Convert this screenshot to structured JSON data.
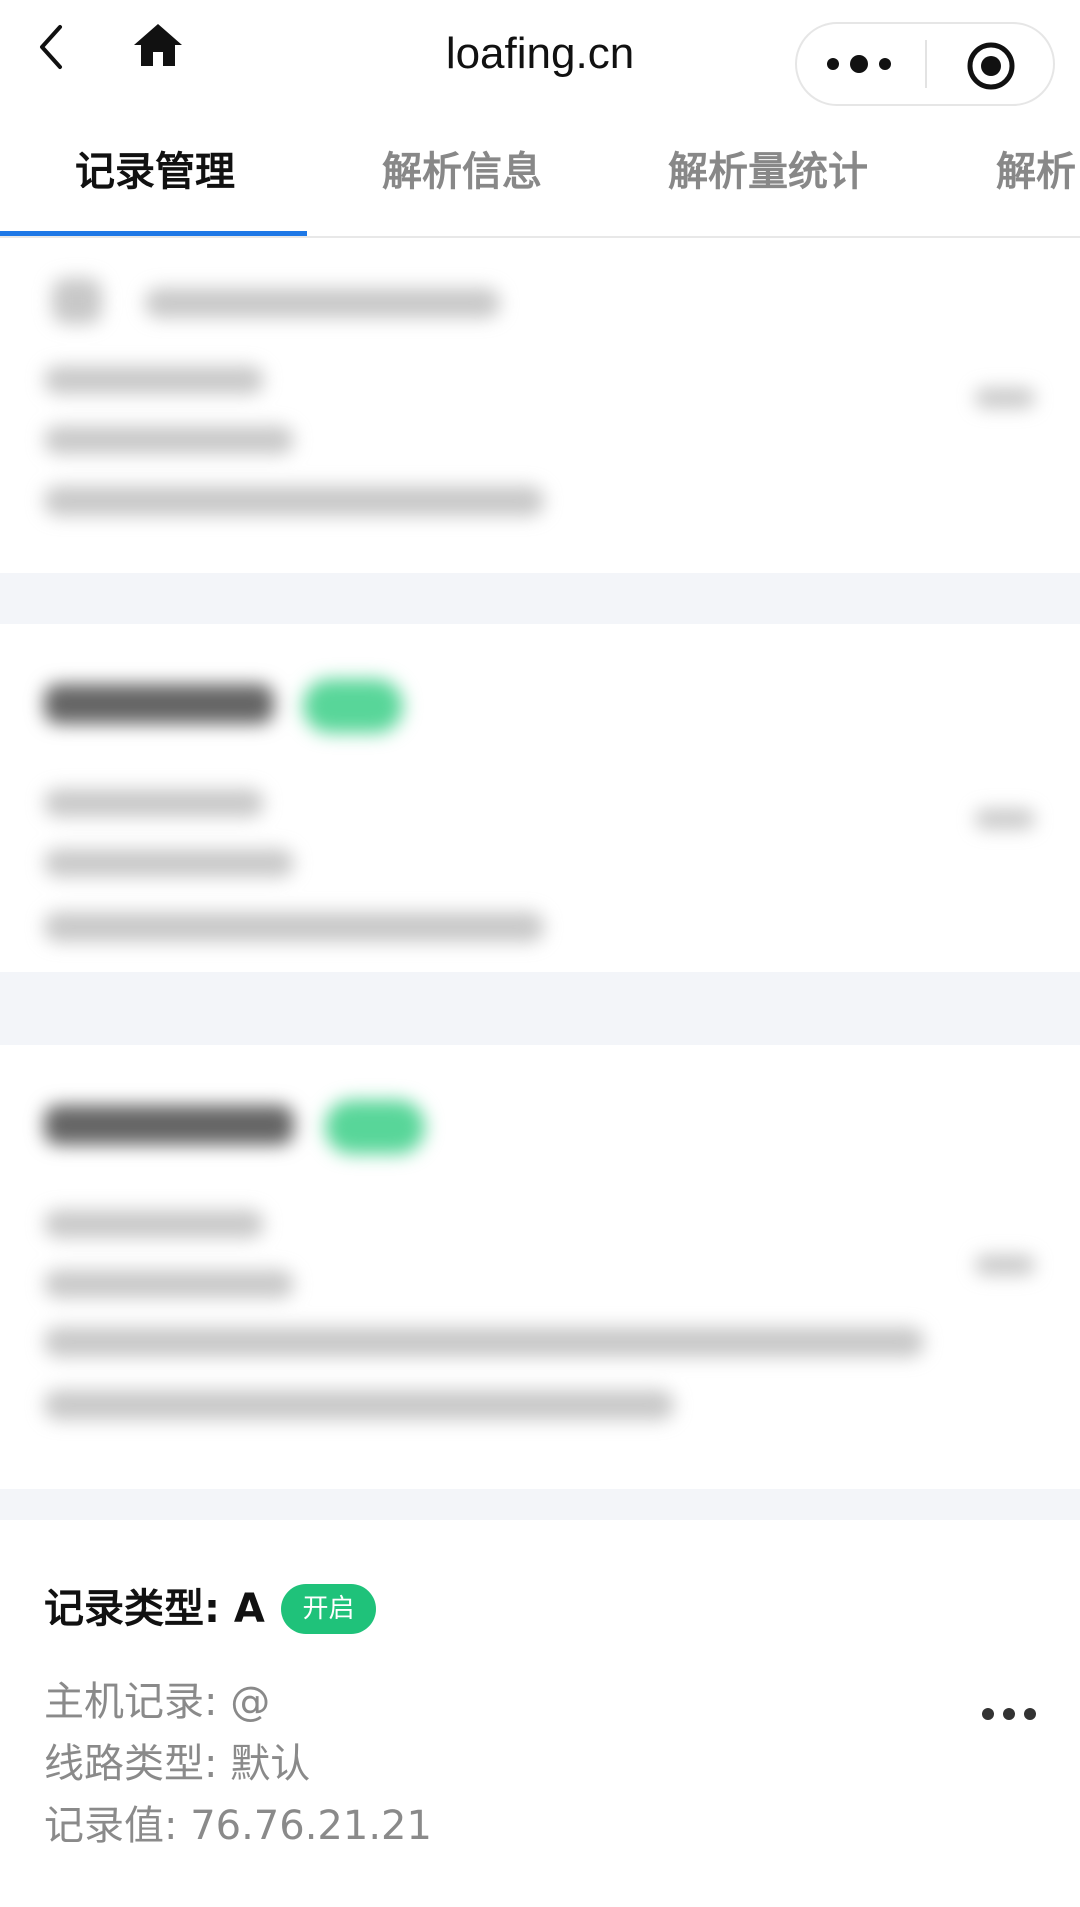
{
  "nav": {
    "title": "loafing.cn",
    "back_icon": "chevron-left-icon",
    "home_icon": "home-icon",
    "more_icon": "more-dots-icon",
    "close_icon": "target-circle-icon"
  },
  "tabs": [
    {
      "label": "记录管理",
      "active": true
    },
    {
      "label": "解析信息",
      "active": false
    },
    {
      "label": "解析量统计",
      "active": false
    },
    {
      "label": "解析",
      "active": false
    }
  ],
  "record": {
    "type_text": "记录类型: A",
    "status": "开启",
    "host": "主机记录: @",
    "line": "线路类型: 默认",
    "value": "记录值: 76.76.21.21",
    "more_icon": "more-horizontal-icon"
  },
  "colors": {
    "accent": "#1e78e6",
    "status_on": "#1fc27a",
    "muted_text": "#8a8a8a"
  }
}
